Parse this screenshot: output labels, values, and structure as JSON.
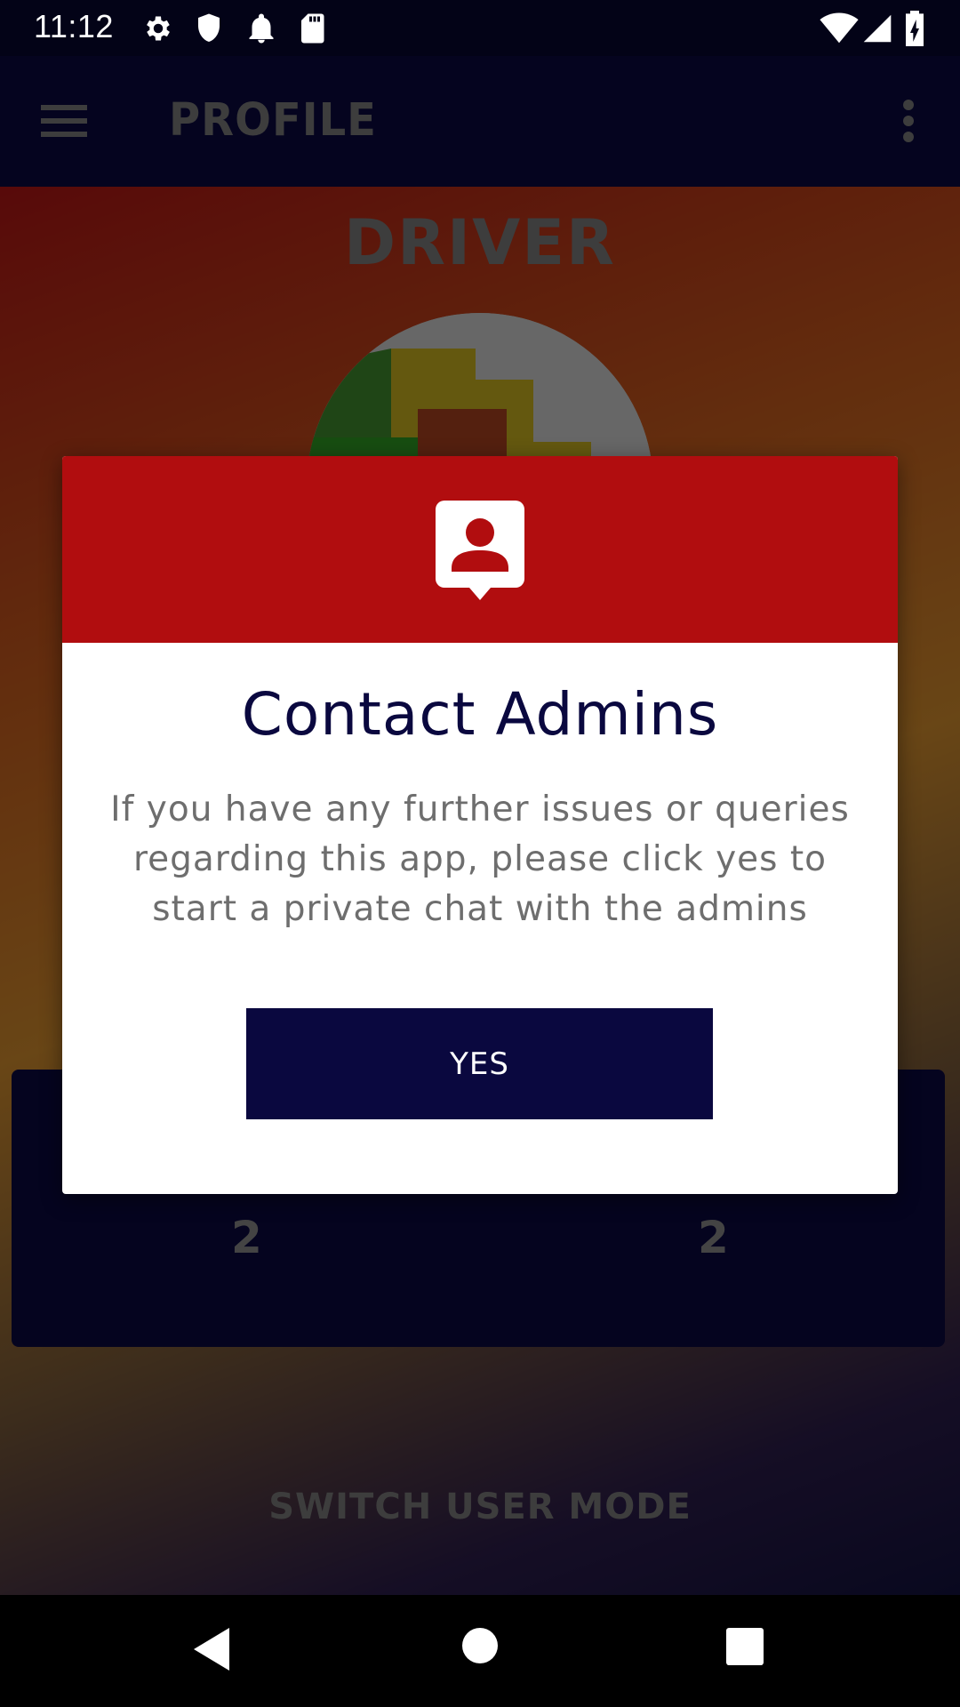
{
  "status_bar": {
    "time": "11:12",
    "icons": [
      "gear-icon",
      "shield-icon",
      "bell-icon",
      "sd-card-icon",
      "wifi-icon",
      "signal-icon",
      "battery-charging-icon"
    ]
  },
  "app_bar": {
    "title": "PROFILE",
    "icons": [
      "menu-icon",
      "more-vert-icon"
    ]
  },
  "profile": {
    "role": "DRIVER",
    "stats": [
      "2",
      "2"
    ],
    "switch_mode_label": "SWITCH USER MODE"
  },
  "dialog": {
    "icon": "contact-admin-icon",
    "title": "Contact Admins",
    "body": "If you have any further issues or queries regarding this app, please click yes to start a private chat with the admins",
    "yes_label": "YES",
    "colors": {
      "header": "#b10d0f",
      "title": "#0a083f",
      "button": "#0a083f"
    }
  },
  "nav_bar": {
    "icons": [
      "back-icon",
      "home-icon",
      "recents-icon"
    ]
  }
}
